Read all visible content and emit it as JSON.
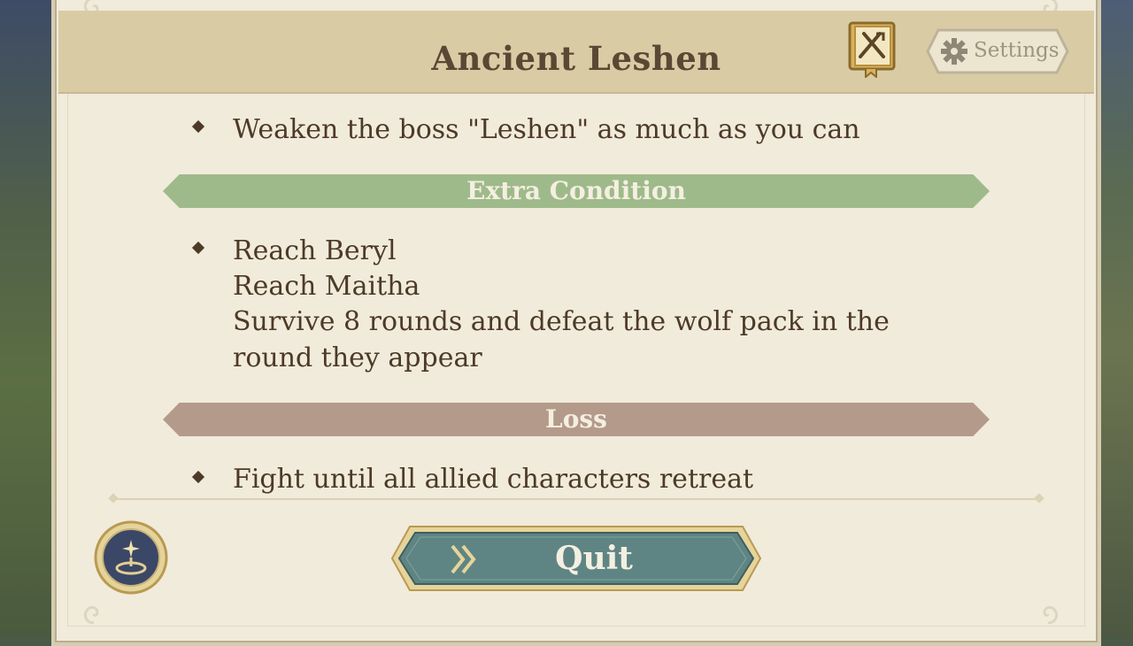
{
  "header": {
    "title": "Ancient Leshen",
    "book_icon": "quest-book-icon",
    "settings_label": "Settings",
    "settings_icon": "gear-icon"
  },
  "victory": {
    "items": [
      "Weaken the boss \"Leshen\" as much as you can"
    ]
  },
  "extra_condition": {
    "banner_label": "Extra Condition",
    "lines": [
      "Reach Beryl",
      "Reach Maitha",
      "Survive 8 rounds and defeat the wolf pack in the",
      "round they appear"
    ]
  },
  "loss": {
    "banner_label": "Loss",
    "items": [
      "Fight until all allied characters retreat"
    ]
  },
  "footer": {
    "quit_label": "Quit",
    "quit_icon": "double-chevron-right-icon",
    "skill_icon": "summon-skill-icon"
  },
  "colors": {
    "panel": "#f1ebdc",
    "header": "#d9cca5",
    "title_text": "#5a4834",
    "body_text": "#4d3a26",
    "extra_banner": "#9fba8a",
    "loss_banner": "#b49a8a",
    "quit_button": "#5e8584"
  }
}
